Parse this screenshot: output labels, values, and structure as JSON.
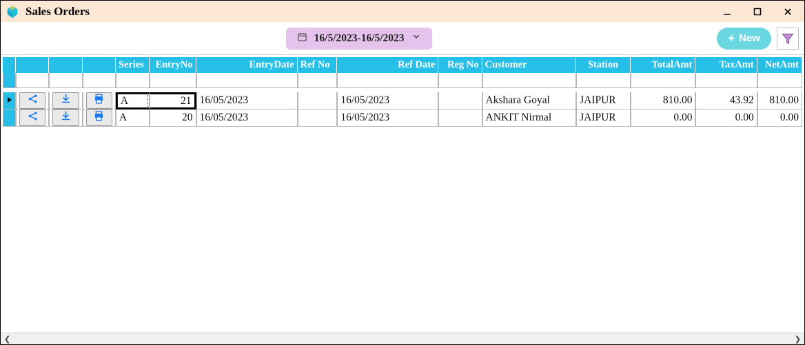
{
  "window": {
    "title": "Sales Orders"
  },
  "toolbar": {
    "date_range": "16/5/2023-16/5/2023",
    "new_label": "New",
    "new_plus": "+"
  },
  "columns": {
    "series": "Series",
    "entryno": "EntryNo",
    "entrydate": "EntryDate",
    "refno": "Ref No",
    "refdate": "Ref Date",
    "regno": "Reg No",
    "customer": "Customer",
    "station": "Station",
    "totalamt": "TotalAmt",
    "taxamt": "TaxAmt",
    "netamt": "NetAmt"
  },
  "rows": [
    {
      "series": "A",
      "entryno": "21",
      "entrydate": "16/05/2023",
      "refno": "",
      "refdate": "16/05/2023",
      "regno": "",
      "customer": "Akshara Goyal",
      "station": "JAIPUR",
      "totalamt": "810.00",
      "taxamt": "43.92",
      "netamt": "810.00",
      "selected": true
    },
    {
      "series": "A",
      "entryno": "20",
      "entrydate": "16/05/2023",
      "refno": "",
      "refdate": "16/05/2023",
      "regno": "",
      "customer": "ANKIT Nirmal",
      "station": "JAIPUR",
      "totalamt": "0.00",
      "taxamt": "0.00",
      "netamt": "0.00",
      "selected": false
    }
  ],
  "icons": {
    "share": "share-icon",
    "download": "download-icon",
    "print": "print-icon",
    "calendar": "calendar-icon",
    "chevron": "chevron-down-icon",
    "funnel": "funnel-icon"
  }
}
